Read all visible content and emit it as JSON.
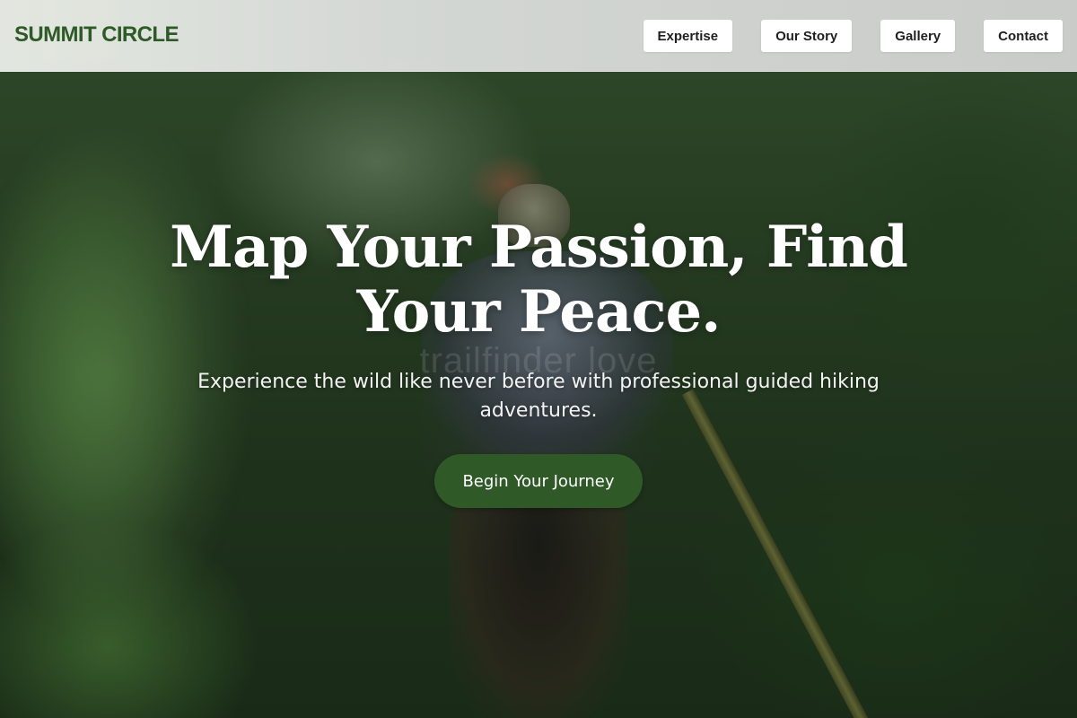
{
  "header": {
    "logo": "SUMMIT CIRCLE",
    "nav": [
      {
        "label": "Expertise"
      },
      {
        "label": "Our Story"
      },
      {
        "label": "Gallery"
      },
      {
        "label": "Contact"
      }
    ]
  },
  "hero": {
    "headline": "Map Your Passion, Find Your Peace.",
    "watermark": "trailfinder love",
    "subheadline": "Experience the wild like never before with professional guided hiking adventures.",
    "cta_label": "Begin Your Journey"
  },
  "colors": {
    "brand_green": "#2e5a27",
    "cta_green": "#2f5a28",
    "nav_button_bg": "#ffffff"
  }
}
